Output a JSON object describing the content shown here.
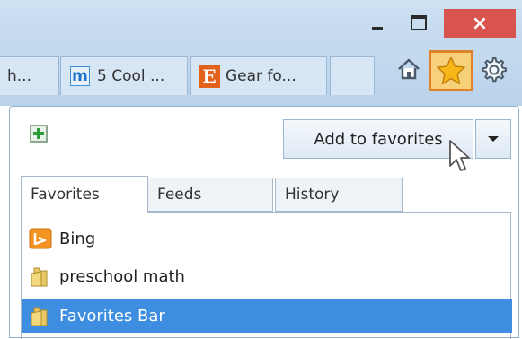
{
  "window": {
    "close_glyph": "×"
  },
  "tabs": [
    {
      "label": "h...",
      "icon": "none"
    },
    {
      "label": "5 Cool ...",
      "icon": "m-site-icon",
      "icon_glyph": "m"
    },
    {
      "label": "Gear fo...",
      "icon": "etsy-icon",
      "icon_glyph": "E"
    },
    {
      "label": "",
      "icon": "none"
    }
  ],
  "toolbar": {
    "home_icon": "home-icon",
    "favorites_icon": "star-icon",
    "tools_icon": "gear-icon",
    "favorites_highlight": "#e0822c"
  },
  "panel": {
    "add_button_label": "Add to favorites",
    "tabs": [
      {
        "label": "Favorites",
        "active": true
      },
      {
        "label": "Feeds",
        "active": false
      },
      {
        "label": "History",
        "active": false
      }
    ],
    "items": [
      {
        "label": "Bing",
        "icon": "bing-icon"
      },
      {
        "label": "preschool math",
        "icon": "folder-icon"
      },
      {
        "label": "Favorites Bar",
        "icon": "folder-icon",
        "selected": true
      }
    ],
    "selection_color": "#3d8de0"
  }
}
